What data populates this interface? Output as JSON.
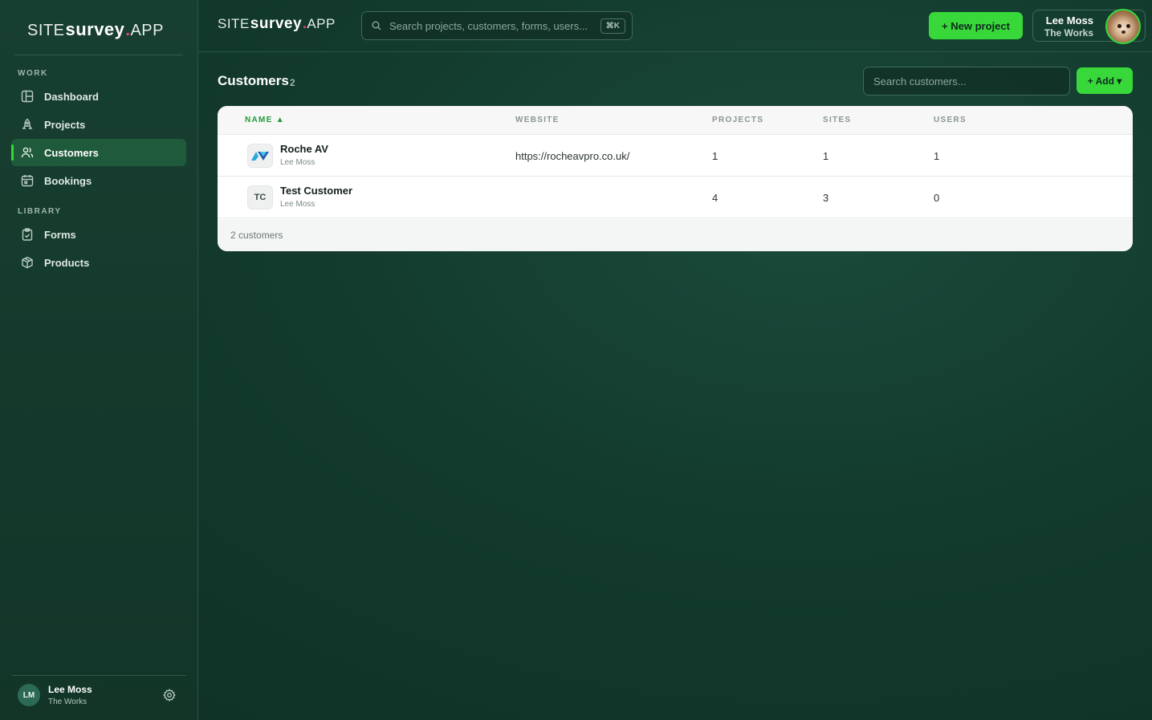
{
  "brand": {
    "site": "SITE",
    "survey": "survey",
    "dot": ".",
    "app": "APP"
  },
  "sidebar": {
    "sections": [
      {
        "label": "WORK"
      },
      {
        "label": "LIBRARY"
      }
    ],
    "items": [
      {
        "label": "Dashboard",
        "icon": "dashboard-icon"
      },
      {
        "label": "Projects",
        "icon": "rocket-icon"
      },
      {
        "label": "Customers",
        "icon": "users-icon",
        "active": true
      },
      {
        "label": "Bookings",
        "icon": "calendar-icon"
      },
      {
        "label": "Forms",
        "icon": "clipboard-icon"
      },
      {
        "label": "Products",
        "icon": "box-icon"
      }
    ],
    "user": {
      "initials": "LM",
      "name": "Lee Moss",
      "org": "The Works"
    }
  },
  "topbar": {
    "search_placeholder": "Search projects, customers, forms, users...",
    "shortcut": "⌘K",
    "new_project_label": "+ New project",
    "user": {
      "name": "Lee Moss",
      "org": "The Works"
    }
  },
  "main": {
    "title": "Customers",
    "count": "2",
    "search_placeholder": "Search customers...",
    "add_label": "+ Add ▾",
    "columns": [
      "NAME ▲",
      "WEBSITE",
      "PROJECTS",
      "SITES",
      "USERS"
    ],
    "rows": [
      {
        "badge": "",
        "name": "Roche AV",
        "owner": "Lee Moss",
        "website": "https://rocheavpro.co.uk/",
        "projects": "1",
        "sites": "1",
        "users": "1"
      },
      {
        "badge": "TC",
        "name": "Test Customer",
        "owner": "Lee Moss",
        "website": "",
        "projects": "4",
        "sites": "3",
        "users": "0"
      }
    ],
    "footer": "2 customers"
  },
  "colors": {
    "accent": "#39d83a",
    "sidebar_bg": "#173f31",
    "page_bg": "#123a2d",
    "sorted_header": "#229a37"
  }
}
